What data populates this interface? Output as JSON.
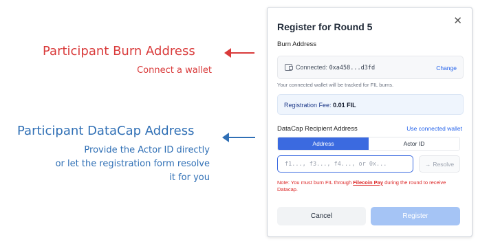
{
  "annotations": {
    "burn": {
      "title": "Participant Burn Address",
      "subtitle": "Connect a wallet",
      "color": "#d93a3a"
    },
    "datacap": {
      "title": "Participant DataCap Address",
      "lines": [
        "Provide the Actor ID directly",
        "or let the registration form resolve",
        "it for you"
      ],
      "color": "#2f6fb5"
    }
  },
  "modal": {
    "title": "Register for Round 5",
    "close_icon": "close-icon",
    "burn_address": {
      "label": "Burn Address",
      "status": "Connected:",
      "address": "0xa458...d3fd",
      "change_label": "Change",
      "wallet_icon": "wallet-icon",
      "hint": "Your connected wallet will be tracked for FIL burns."
    },
    "fee": {
      "label": "Registration Fee:",
      "amount": "0.01 FIL"
    },
    "datacap": {
      "label": "DataCap Recipient Address",
      "use_wallet_label": "Use connected wallet",
      "tabs": [
        {
          "label": "Address",
          "active": true
        },
        {
          "label": "Actor ID",
          "active": false
        }
      ],
      "input_placeholder": "f1..., f3..., f4..., or 0x...",
      "input_value": "",
      "resolve_label": "Resolve",
      "resolve_icon": "arrow-right-icon"
    },
    "note": {
      "prefix": "Note: You must burn FIL through",
      "link": "Filecoin Pay",
      "suffix": "during the round to receive Datacap."
    },
    "buttons": {
      "cancel": "Cancel",
      "register": "Register"
    }
  },
  "colors": {
    "accent": "#3b6ae0",
    "link": "#2563eb",
    "register_disabled": "#a5c4f5",
    "note_red": "#dc2626"
  }
}
